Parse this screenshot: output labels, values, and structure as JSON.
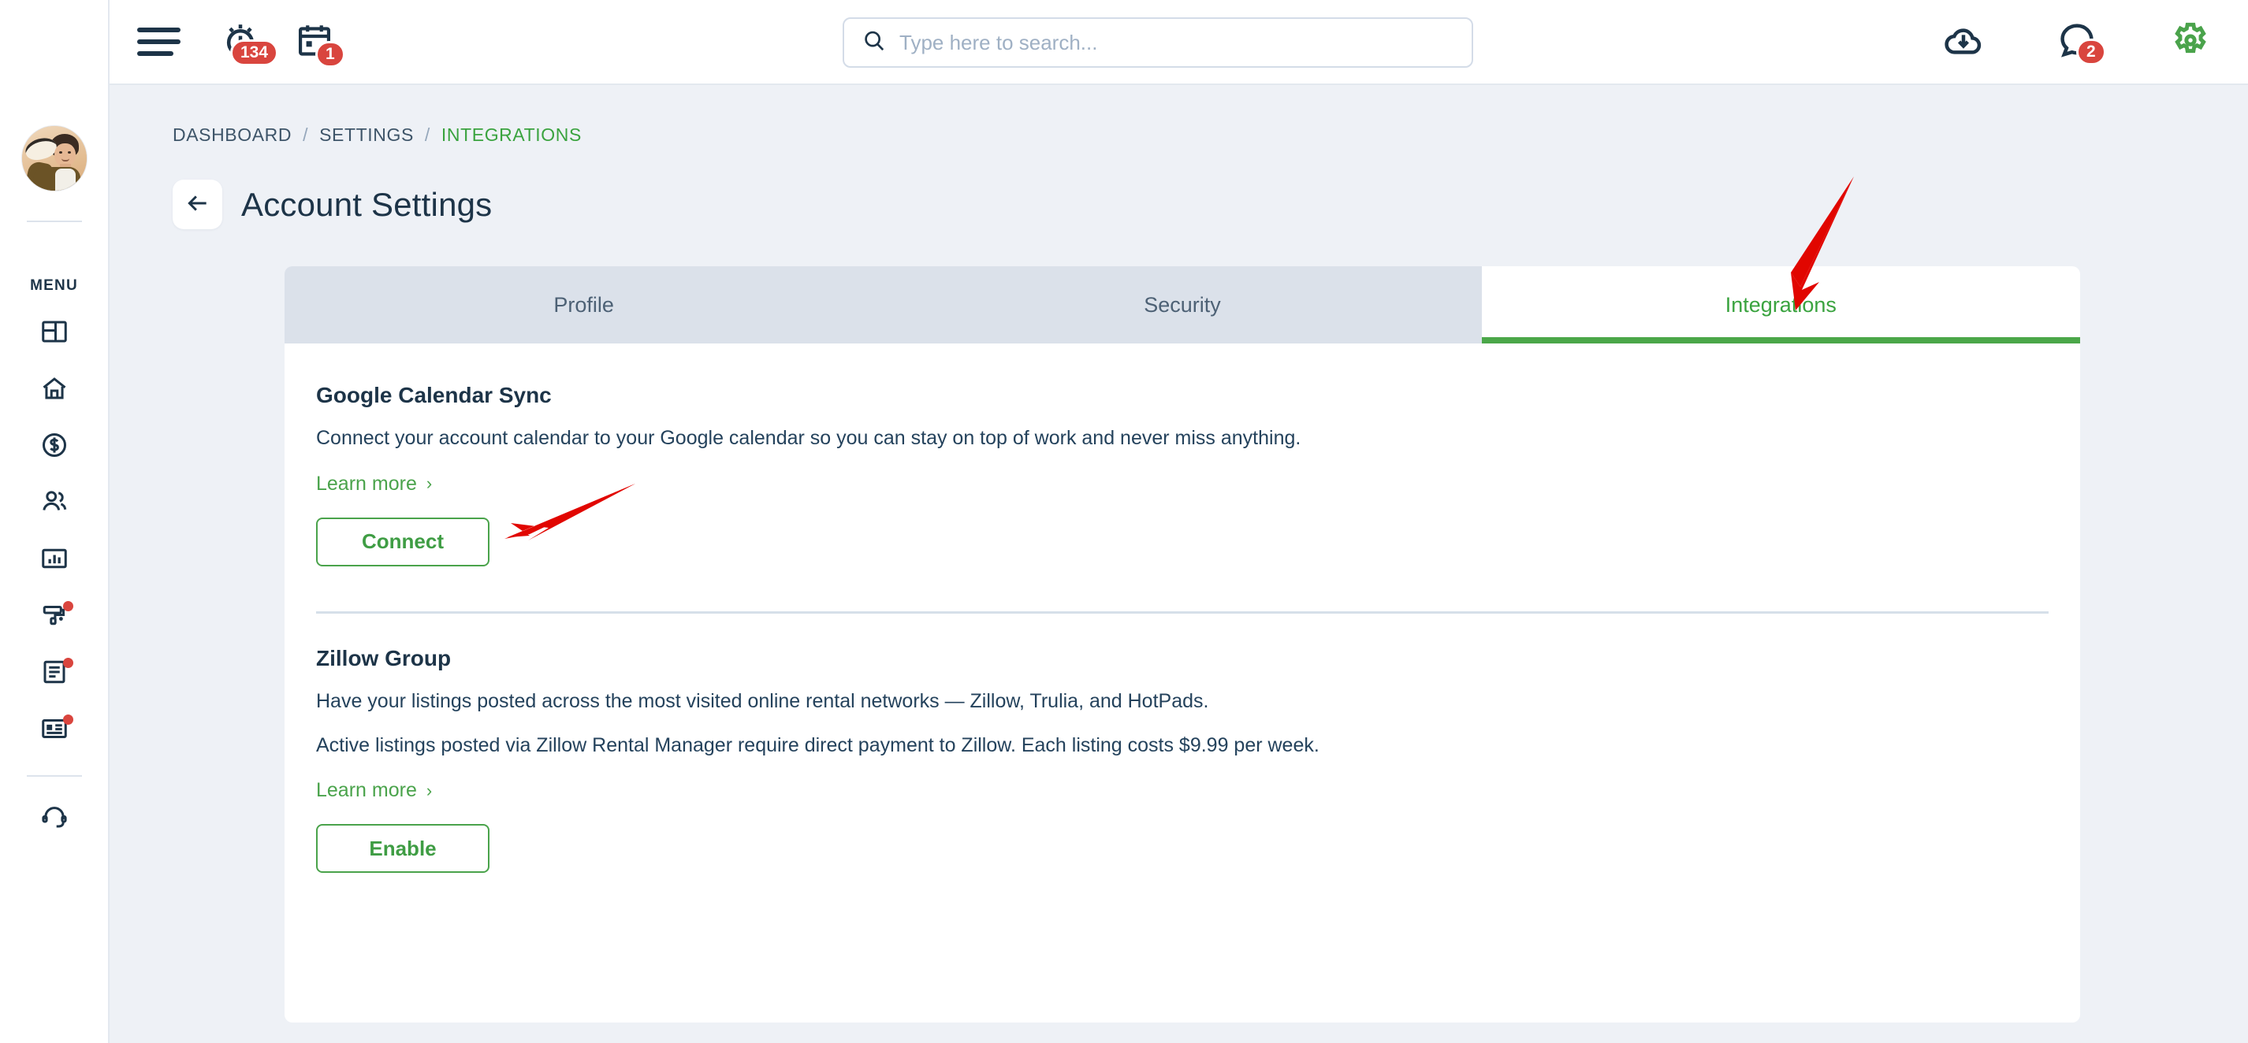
{
  "header": {
    "menu_icon": "hamburger-icon",
    "alarm": {
      "icon": "alarm-clock-icon",
      "badge": "134"
    },
    "calendar": {
      "icon": "calendar-icon",
      "badge": "1"
    },
    "search": {
      "icon": "search-icon",
      "placeholder": "Type here to search...",
      "value": ""
    },
    "download": {
      "icon": "cloud-download-icon"
    },
    "messages": {
      "icon": "chat-bubble-icon",
      "badge": "2"
    },
    "settings": {
      "icon": "gear-icon",
      "color": "#4aa34b"
    }
  },
  "sidebar": {
    "avatar_alt": "user-avatar",
    "menu_label": "MENU",
    "items": [
      {
        "icon": "dashboard-grid-icon",
        "name": "dashboard",
        "dot": false
      },
      {
        "icon": "home-icon",
        "name": "properties",
        "dot": false
      },
      {
        "icon": "dollar-circle-icon",
        "name": "accounting",
        "dot": false
      },
      {
        "icon": "people-icon",
        "name": "people",
        "dot": false
      },
      {
        "icon": "bar-chart-icon",
        "name": "reports",
        "dot": false
      },
      {
        "icon": "paint-roller-icon",
        "name": "maintenance",
        "dot": true
      },
      {
        "icon": "document-icon",
        "name": "tasks",
        "dot": true
      },
      {
        "icon": "id-card-icon",
        "name": "listings",
        "dot": true
      }
    ],
    "support": {
      "icon": "headset-icon",
      "name": "support"
    }
  },
  "breadcrumb": [
    {
      "label": "DASHBOARD",
      "active": false
    },
    {
      "label": "SETTINGS",
      "active": false
    },
    {
      "label": "INTEGRATIONS",
      "active": true
    }
  ],
  "breadcrumb_separator": "/",
  "page": {
    "back_icon": "arrow-left-icon",
    "title": "Account Settings"
  },
  "tabs": [
    {
      "label": "Profile",
      "active": false
    },
    {
      "label": "Security",
      "active": false
    },
    {
      "label": "Integrations",
      "active": true
    }
  ],
  "sections": [
    {
      "title": "Google Calendar Sync",
      "description": "Connect your account calendar to your Google calendar so you can stay on top of work and never miss anything.",
      "description2": "",
      "learn_more": "Learn more",
      "learn_more_chevron": "›",
      "button": "Connect"
    },
    {
      "title": "Zillow Group",
      "description": "Have your listings posted across the most visited online rental networks — Zillow, Trulia, and HotPads.",
      "description2": "Active listings posted via Zillow Rental Manager require direct payment to Zillow. Each listing costs $9.99 per week.",
      "learn_more": "Learn more",
      "learn_more_chevron": "›",
      "button": "Enable"
    }
  ],
  "annotations": [
    {
      "name": "arrow-pointing-to-integrations-tab",
      "color": "#e10600"
    },
    {
      "name": "arrow-pointing-to-connect-button",
      "color": "#e10600"
    }
  ],
  "colors": {
    "accent_green": "#4aa34b",
    "badge_red": "#d9453e",
    "navy": "#1d3448",
    "page_bg": "#eef1f6",
    "tab_inactive_bg": "#dbe1ea"
  }
}
